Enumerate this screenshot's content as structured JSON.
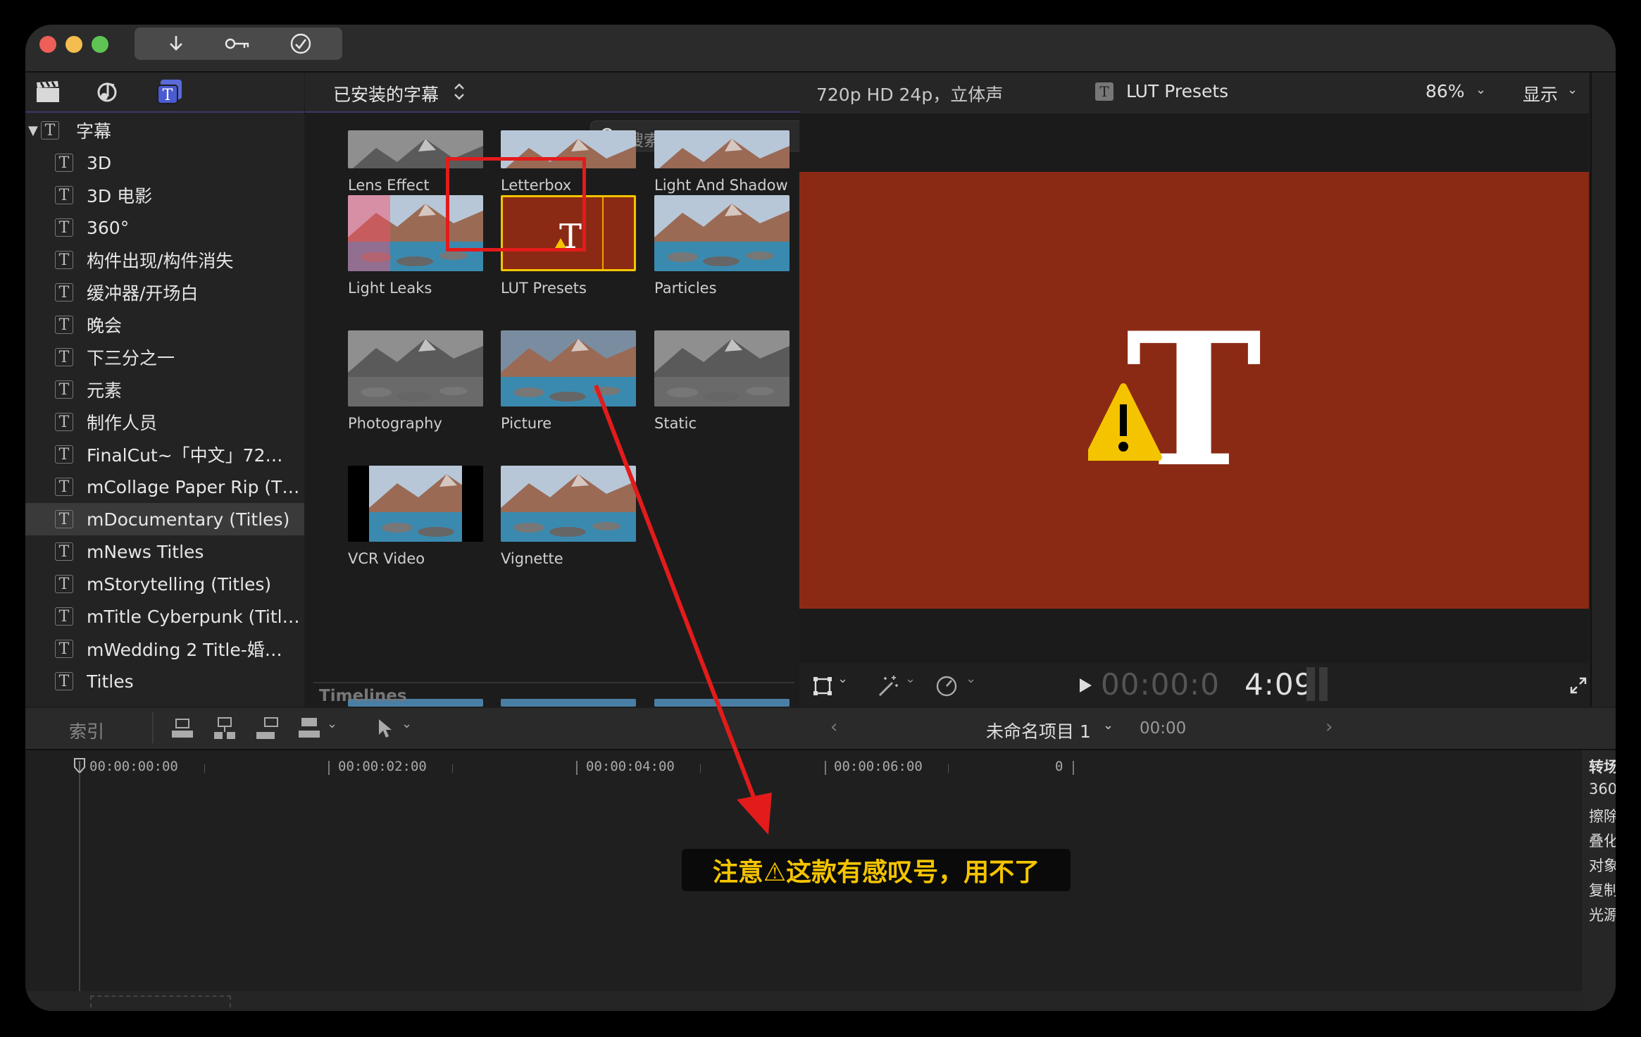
{
  "toolbar": {
    "import_icon": "download-arrow",
    "keywords_icon": "key",
    "analysis_icon": "checkmark-circle"
  },
  "library": {
    "header_icons": [
      "clapper-icon",
      "music-photo-icon",
      "titles-icon"
    ],
    "root_label": "字幕",
    "items": [
      {
        "label": "3D"
      },
      {
        "label": "3D 电影"
      },
      {
        "label": "360°"
      },
      {
        "label": "构件出现/构件消失"
      },
      {
        "label": "缓冲器/开场白"
      },
      {
        "label": "晚会"
      },
      {
        "label": "下三分之一"
      },
      {
        "label": "元素"
      },
      {
        "label": "制作人员"
      },
      {
        "label": "FinalCut~「中文」72…"
      },
      {
        "label": "mCollage Paper Rip (T…"
      },
      {
        "label": "mDocumentary (Titles)"
      },
      {
        "label": "mNews Titles"
      },
      {
        "label": "mStorytelling (Titles)"
      },
      {
        "label": "mTitle Cyberpunk (Titl…"
      },
      {
        "label": "mWedding 2 Title-婚…"
      },
      {
        "label": "Titles"
      }
    ],
    "selected_index": 11
  },
  "browser": {
    "filter_label": "已安装的字幕",
    "search_placeholder": "搜索",
    "items": [
      {
        "label": "Lens Effect"
      },
      {
        "label": "Letterbox"
      },
      {
        "label": "Light And Shadow"
      },
      {
        "label": "Light Leaks"
      },
      {
        "label": "LUT Presets"
      },
      {
        "label": "Particles"
      },
      {
        "label": "Photography"
      },
      {
        "label": "Picture"
      },
      {
        "label": "Static"
      },
      {
        "label": "VCR Video"
      },
      {
        "label": "Vignette"
      }
    ],
    "section_label": "Timelines"
  },
  "viewer": {
    "format": "720p HD 24p，立体声",
    "clip_name": "LUT Presets",
    "zoom": "86%",
    "display_menu": "显示",
    "timecode_dim": "00:00:0",
    "timecode_bright": "4:09",
    "preview_color": "#8b2a14"
  },
  "timeline": {
    "index_label": "索引",
    "project_name": "未命名项目 1",
    "project_time": "00:00",
    "ruler": [
      "00:00:00:00",
      "00:00:02:00",
      "00:00:04:00",
      "00:00:06:00",
      "0"
    ],
    "side_panel": [
      "转场",
      "360",
      "擦除",
      "叠化",
      "对象",
      "复制",
      "光源"
    ]
  },
  "annotation": {
    "caption": "注意⚠这款有感叹号，用不了",
    "box_color": "#e31b1b"
  }
}
